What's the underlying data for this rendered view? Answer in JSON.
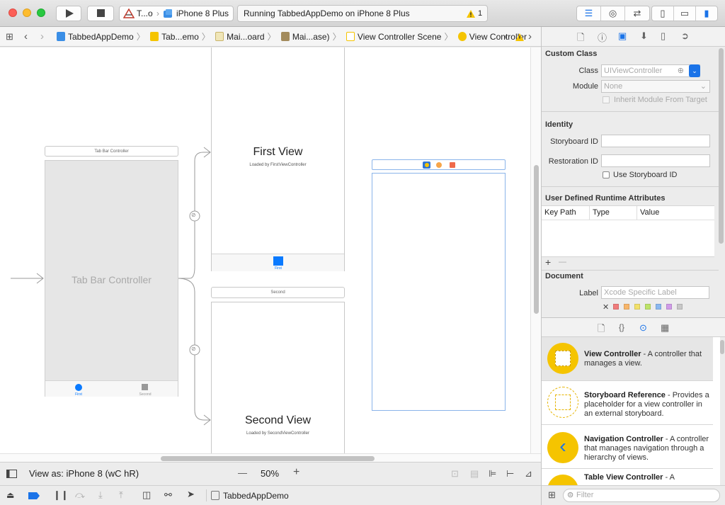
{
  "toolbar": {
    "scheme_target": "T...o",
    "device": "iPhone 8 Plus",
    "status": "Running TabbedAppDemo on iPhone 8 Plus",
    "warning_count": "1"
  },
  "jumpbar": {
    "crumbs": [
      "TabbedAppDemo",
      "Tab...emo",
      "Mai...oard",
      "Mai...ase)",
      "View Controller Scene",
      "View Controller"
    ]
  },
  "canvas": {
    "tabbar_title": "Tab Bar Controller",
    "tabbar_body": "Tab Bar Controller",
    "tab_first": "First",
    "tab_second": "Second",
    "first_view_title": "First View",
    "first_view_sub": "Loaded by FirstViewController",
    "first_tab_label": "First",
    "second_scene_title": "Second",
    "second_view_title": "Second View",
    "second_view_sub": "Loaded by SecondViewController"
  },
  "bottombar": {
    "view_as": "View as: iPhone 8 (wC hR)",
    "zoom": "50%",
    "zoom_minus": "—",
    "zoom_plus": "+"
  },
  "debugbar": {
    "target": "TabbedAppDemo"
  },
  "inspector": {
    "custom_class": {
      "header": "Custom Class",
      "class_label": "Class",
      "class_placeholder": "UIViewController",
      "module_label": "Module",
      "module_value": "None",
      "inherit_label": "Inherit Module From Target"
    },
    "identity": {
      "header": "Identity",
      "storyboard_id_label": "Storyboard ID",
      "restoration_id_label": "Restoration ID",
      "use_storyboard_id_label": "Use Storyboard ID"
    },
    "runtime_attrs": {
      "header": "User Defined Runtime Attributes",
      "columns": [
        "Key Path",
        "Type",
        "Value"
      ],
      "add": "+",
      "remove": "—"
    },
    "document": {
      "header": "Document",
      "label_label": "Label",
      "label_placeholder": "Xcode Specific Label",
      "clear": "✕",
      "swatches": [
        "#f07b7b",
        "#f7b56a",
        "#f2e16a",
        "#bde36a",
        "#8ab8f0",
        "#d09be8",
        "#c8c8c8"
      ]
    }
  },
  "library": {
    "items": [
      {
        "title": "View Controller",
        "desc": " - A controller that manages a view."
      },
      {
        "title": "Storyboard Reference",
        "desc": " - Provides a placeholder for a view controller in an external storyboard."
      },
      {
        "title": "Navigation Controller",
        "desc": " - A controller that manages navigation through a hierarchy of views."
      },
      {
        "title": "Table View Controller",
        "desc": " - A"
      }
    ],
    "filter_placeholder": "Filter"
  },
  "colors": {
    "accent": "#1a73e8",
    "warning": "#f5c400",
    "ios_blue": "#0a7aff"
  }
}
